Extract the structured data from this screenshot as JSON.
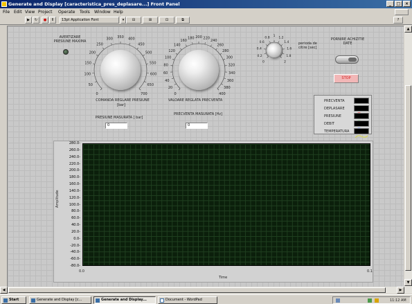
{
  "window": {
    "title": "Generate and Display [caracteristica_pres_deplasare...] Front Panel"
  },
  "menu": [
    "File",
    "Edit",
    "View",
    "Project",
    "Operate",
    "Tools",
    "Window",
    "Help"
  ],
  "toolbar": {
    "font": "13pt Application Font"
  },
  "alarm": {
    "label": "AVERTIZARE PRESIUNE MAXIMA"
  },
  "knob1": {
    "ticks": [
      "0",
      "50",
      "100",
      "150",
      "200",
      "250",
      "300",
      "350",
      "400",
      "450",
      "500",
      "550",
      "600",
      "650",
      "700"
    ],
    "title": "COMANDA REGLARE PRESIUNE",
    "unit": "[bar]"
  },
  "knob2": {
    "ticks": [
      "0",
      "20",
      "40",
      "60",
      "80",
      "100",
      "120",
      "140",
      "160",
      "180",
      "200",
      "220",
      "240",
      "260",
      "280",
      "300",
      "320",
      "340",
      "360",
      "380",
      "400"
    ],
    "title": "VALOARE REGLATA PRECVENTA"
  },
  "knob3": {
    "ticks": [
      "0",
      "0.2",
      "0.4",
      "0.6",
      "0.8",
      "1",
      "1.2",
      "1.4",
      "1.6",
      "1.8",
      "2"
    ],
    "label": "perioda de citire [sec]"
  },
  "pornire": {
    "label": "PORNIRE ACHIZITIE DATE"
  },
  "stop": {
    "label": "STOP"
  },
  "pressure_meas": {
    "label": "PRESIUNE MASURATA [ bar]",
    "value": "0"
  },
  "freq_meas": {
    "label": "PRECVENTA MASURATA [Hz]",
    "value": "0"
  },
  "legend": [
    "PRECVENTA",
    "DEPLASARE",
    "PRESIUNE",
    "DEBIT",
    "TEMPERATURA"
  ],
  "legend_colors": [
    "#cfe8cf",
    "#ff3030",
    "#7fd67f",
    "#7090ff",
    "#d8d840"
  ],
  "graph": {
    "ylabel": "Amplitude",
    "xlabel": "Time",
    "yticks": [
      "280.0",
      "260.0",
      "240.0",
      "220.0",
      "200.0",
      "180.0",
      "160.0",
      "140.0",
      "120.0",
      "100.0",
      "80.0",
      "60.0",
      "40.0",
      "20.0",
      "0.0",
      "-20.0",
      "-40.0",
      "-60.0",
      "-80.0"
    ],
    "xticks": [
      "0.0",
      "0.1"
    ]
  },
  "taskbar": {
    "start": "Start",
    "tasks": [
      "Generate and Display [c...",
      "Generate and Display...",
      "Document - WordPad"
    ],
    "clock": "11:12 AM"
  }
}
